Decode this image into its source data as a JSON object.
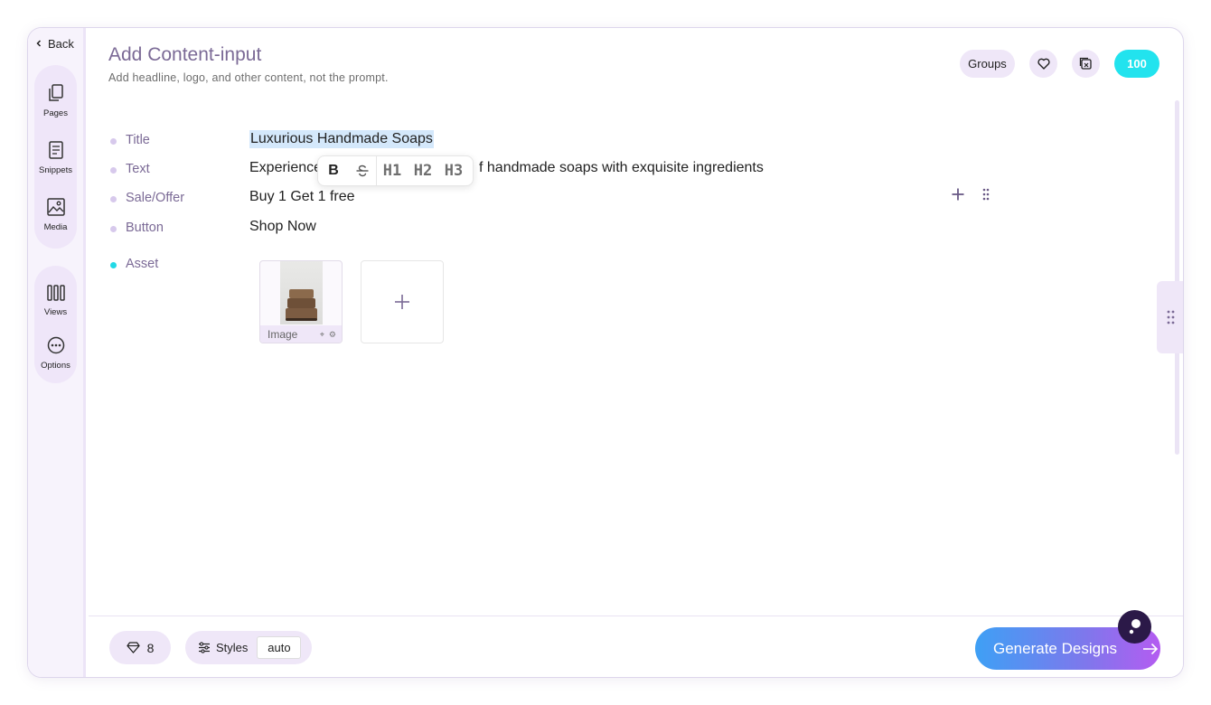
{
  "nav": {
    "back_label": "Back"
  },
  "sidebar": {
    "items": [
      {
        "label": "Pages",
        "icon": "pages-icon"
      },
      {
        "label": "Snippets",
        "icon": "snippets-icon"
      },
      {
        "label": "Media",
        "icon": "media-icon"
      },
      {
        "label": "Views",
        "icon": "views-icon"
      },
      {
        "label": "Options",
        "icon": "options-icon"
      }
    ]
  },
  "header": {
    "title": "Add Content-input",
    "subtitle": "Add headline, logo, and other content, not the prompt."
  },
  "topbar": {
    "groups_label": "Groups",
    "credits": "100",
    "credits_color": "#22e3ee"
  },
  "fields": [
    {
      "label": "Title",
      "value": "Luxurious Handmade Soaps"
    },
    {
      "label": "Text",
      "value_start": "Experience",
      "value_end": "f handmade soaps with exquisite ingredients"
    },
    {
      "label": "Sale/Offer",
      "value": "Buy 1 Get 1 free"
    },
    {
      "label": "Button",
      "value": "Shop Now"
    },
    {
      "label": "Asset"
    }
  ],
  "format_toolbar": {
    "bold": "B",
    "h1": "H1",
    "h2": "H2",
    "h3": "H3"
  },
  "asset": {
    "label": "Image"
  },
  "footer": {
    "gems_count": "8",
    "styles_label": "Styles",
    "styles_value": "auto",
    "generate_label": "Generate Designs"
  },
  "colors": {
    "accent_purple": "#7b6a96",
    "pill_bg": "#efe7f8",
    "selection": "#d4e8fb"
  }
}
